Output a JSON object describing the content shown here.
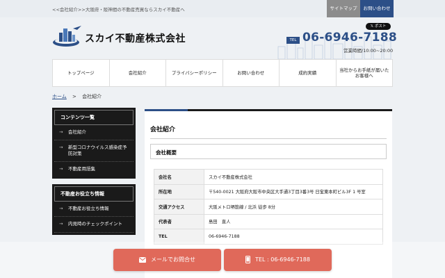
{
  "topbar": {
    "tagline": "<<会社紹介>>大阪府・阪神間の不動産売買ならスカイ不動産へ",
    "sitemap": "サイトマップ",
    "contact": "お問い合わせ"
  },
  "header": {
    "company_name": "スカイ不動産株式会社",
    "post_button": "𝕏 ポスト",
    "tel_badge": "TEL",
    "tel_number": "06-6946-7188",
    "hours": "営業時間/10:00~20:00"
  },
  "nav": [
    {
      "label": "トップページ"
    },
    {
      "label": "会社紹介"
    },
    {
      "label": "プライバシーポリシー"
    },
    {
      "label": "お問い合わせ"
    },
    {
      "label": "成約実績"
    },
    {
      "label": "当社からお手紙が届いたお客様へ"
    }
  ],
  "breadcrumb": {
    "home": "ホーム",
    "separator": ">",
    "current": "会社紹介"
  },
  "sidebar": {
    "box1_title": "コンテンツ一覧",
    "box1_items": [
      "会社紹介",
      "新型コロナウイルス感染症予防対策",
      "不動産用語集"
    ],
    "box2_title": "不動産お役立ち情報",
    "box2_items": [
      "不動産お役立ち情報",
      "内見時のチェックポイント"
    ]
  },
  "main": {
    "page_title": "会社紹介",
    "section_title": "会社概要",
    "table": [
      {
        "label": "会社名",
        "value": "スカイ不動産株式会社"
      },
      {
        "label": "所在地",
        "value": "〒540-0021 大阪府大阪市中央区大手通3丁目3番3号 日宝東本町ビル3F 1 号室"
      },
      {
        "label": "交通アクセス",
        "value": "大阪メトロ堺筋線 / 北浜 徒歩 8分"
      },
      {
        "label": "代表者",
        "value": "島田　直人"
      },
      {
        "label": "TEL",
        "value": "06-6946-7188"
      }
    ]
  },
  "cta": {
    "mail_label": "メールでお問合せ",
    "tel_label": "TEL : 06-6946-7188"
  },
  "colors": {
    "brand_blue": "#2c4f87",
    "cta_coral": "#e0695a",
    "sidebar_dark": "#1a1a1a"
  }
}
